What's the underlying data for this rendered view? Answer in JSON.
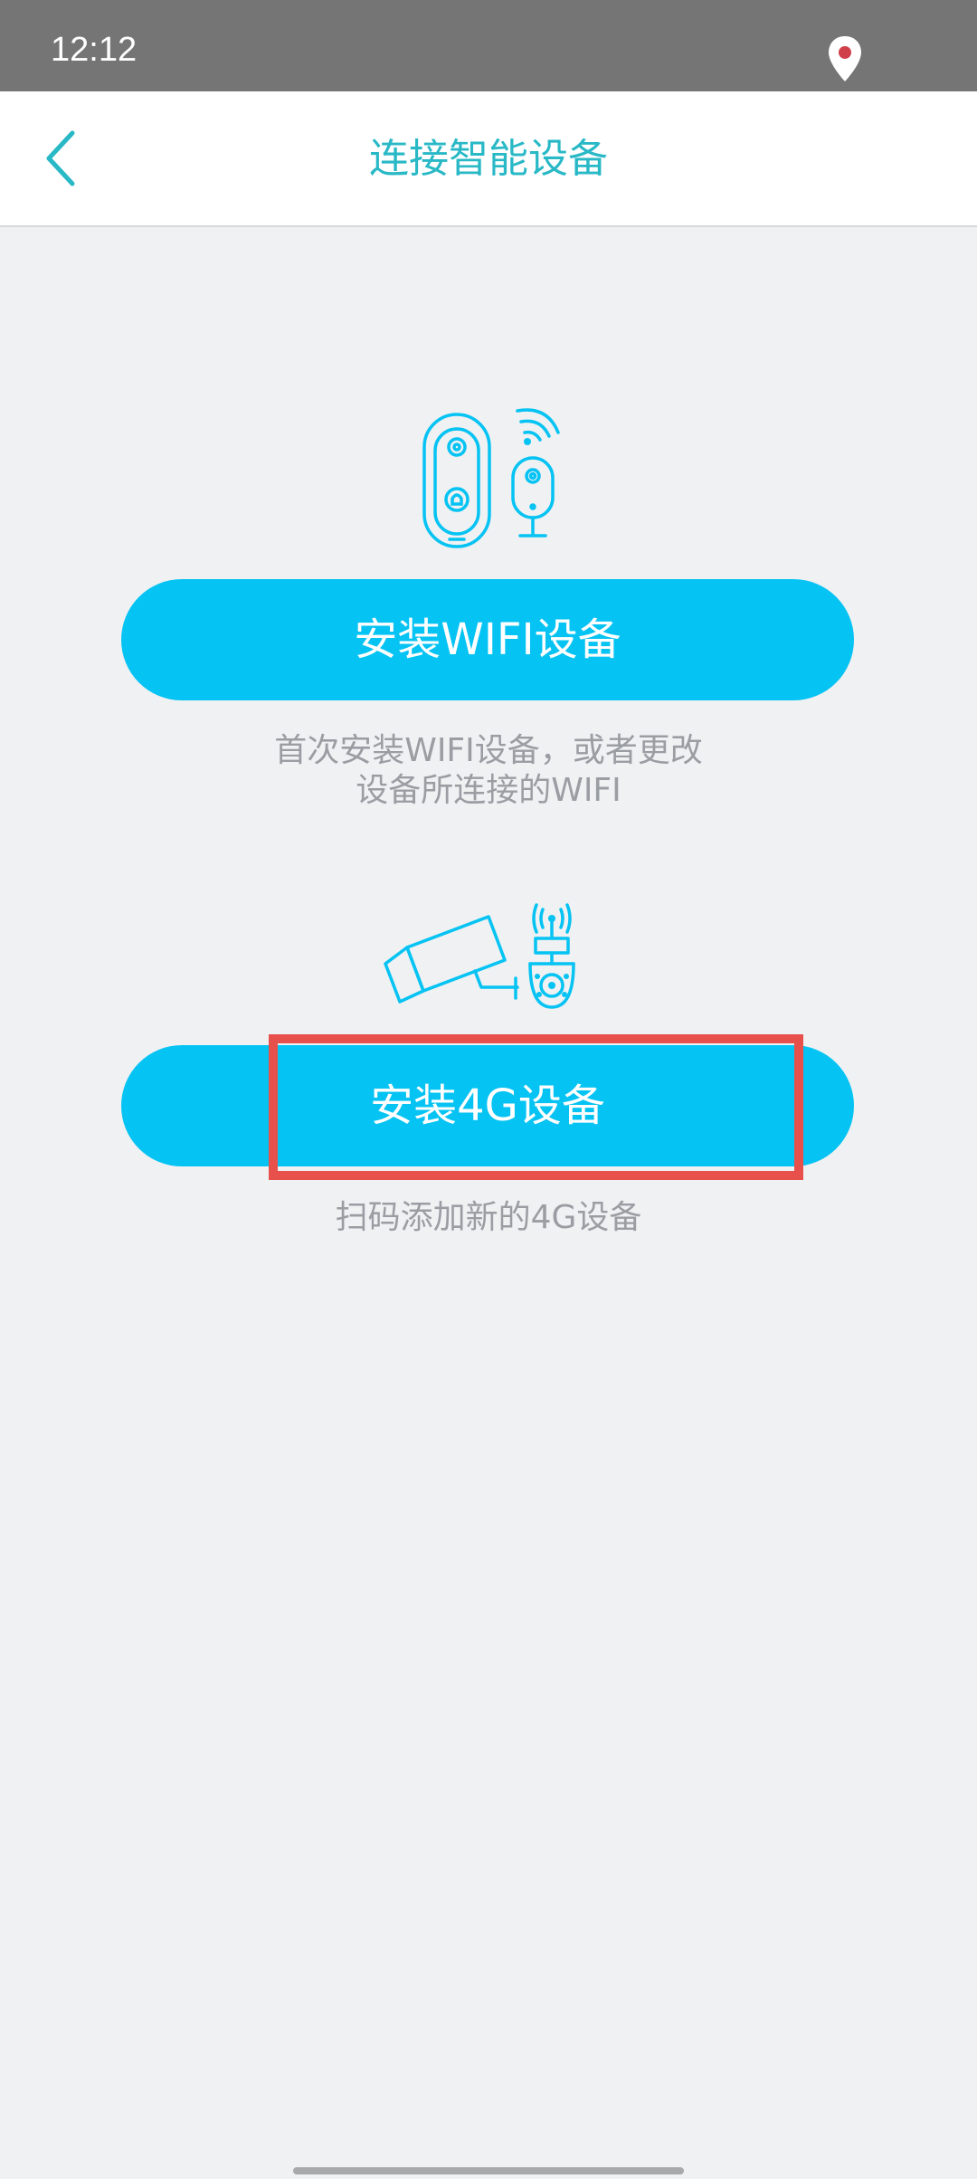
{
  "status_bar": {
    "time": "12:12",
    "icons": [
      "location-pin-icon"
    ]
  },
  "header": {
    "title": "连接智能设备",
    "back_icon": "chevron-left-icon"
  },
  "options": [
    {
      "illustration": "wifi-doorbell-camera-illustration",
      "button_label": "安装WIFI设备",
      "caption_line1": "首次安装WIFI设备，或者更改",
      "caption_line2": "设备所连接的WIFI"
    },
    {
      "illustration": "4g-camera-illustration",
      "button_label": "安装4G设备",
      "caption": "扫码添加新的4G设备"
    }
  ],
  "colors": {
    "accent": "#05c3f3",
    "title": "#28b8c6",
    "highlight": "#e8504c",
    "status_bar": "#757575",
    "background": "#eff1f3"
  }
}
